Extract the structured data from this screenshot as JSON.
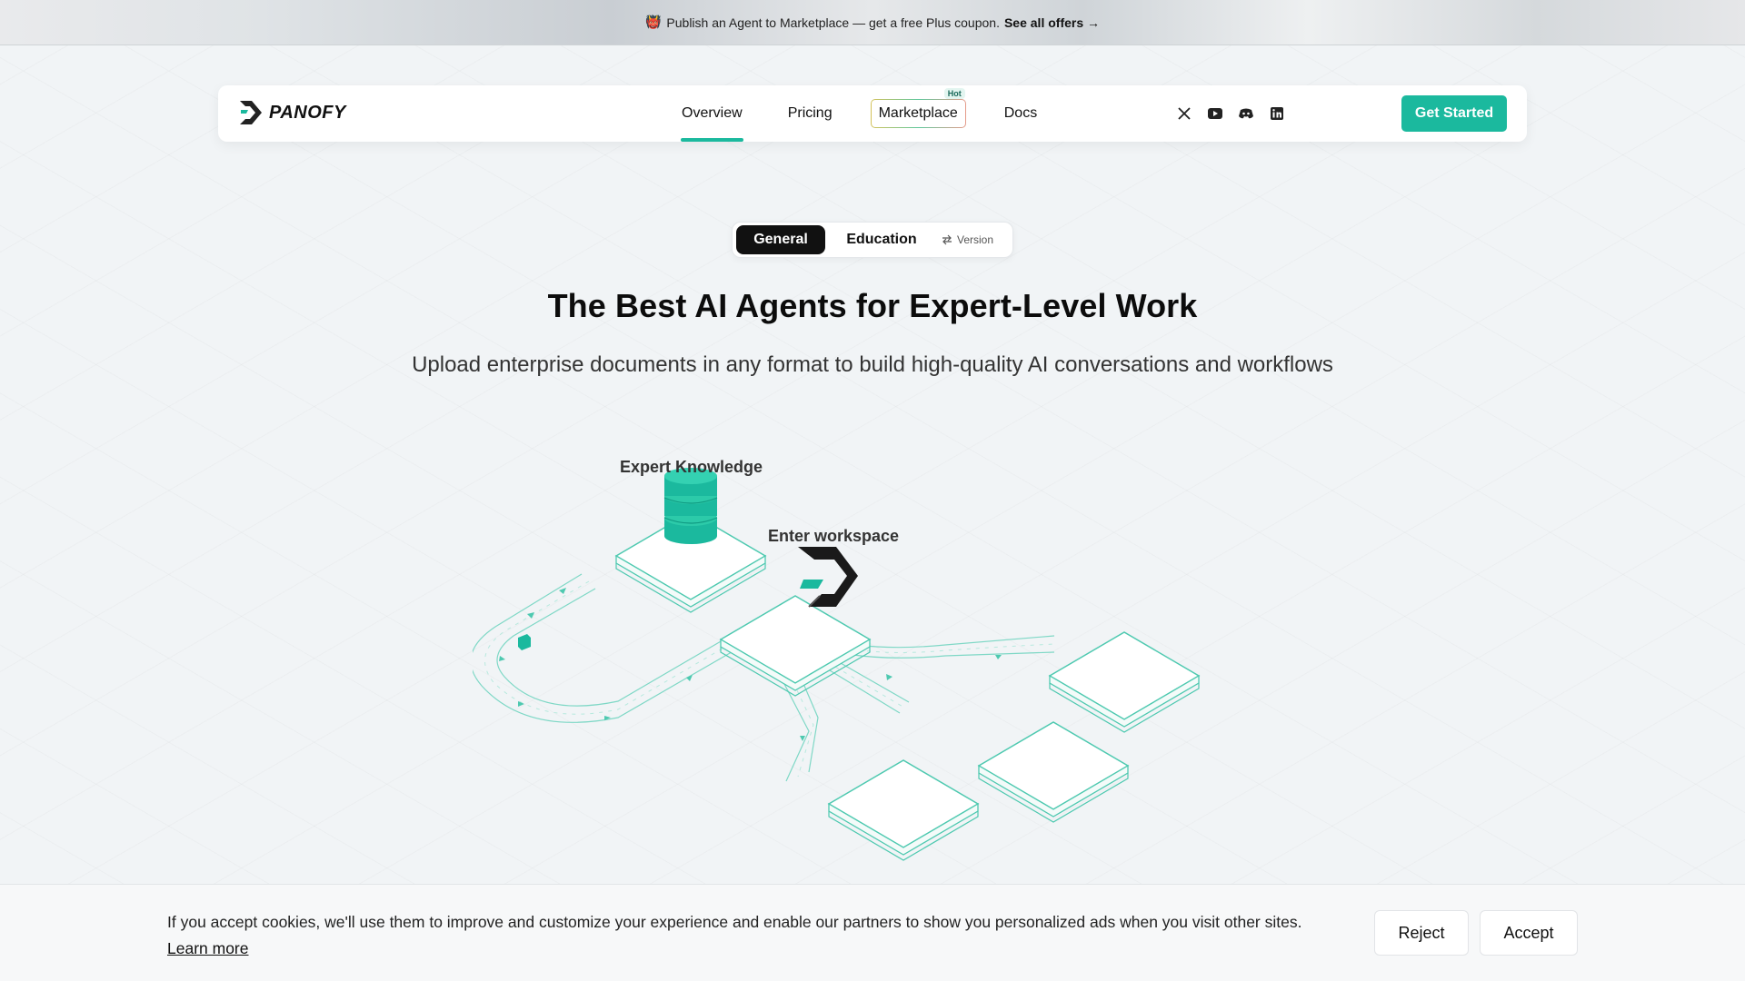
{
  "promo": {
    "emoji": "👹",
    "text": "Publish an Agent to Marketplace — get a free Plus coupon.",
    "link": "See all offers →"
  },
  "nav": {
    "brand": "PANOFY",
    "links": [
      "Overview",
      "Pricing",
      "Marketplace",
      "Docs"
    ],
    "hot_badge": "Hot",
    "active": "Overview",
    "social_icons": [
      "x-icon",
      "youtube-icon",
      "discord-icon",
      "linkedin-icon"
    ],
    "cta": "Get Started"
  },
  "toggle": {
    "general": "General",
    "education": "Education",
    "version": "Version"
  },
  "hero": {
    "title": "The Best AI Agents for Expert-Level Work",
    "subtitle": "Upload enterprise documents in any format to build high-quality AI conversations and workflows"
  },
  "illustration": {
    "label_knowledge": "Expert Knowledge",
    "label_workspace": "Enter workspace"
  },
  "cookie": {
    "text": "If you accept cookies, we'll use them to improve and customize your experience and enable our partners to show you personalized ads when you visit other sites.",
    "learn_more": "Learn more",
    "reject": "Reject",
    "accept": "Accept"
  },
  "colors": {
    "accent": "#1bb99e",
    "dark": "#111111"
  }
}
